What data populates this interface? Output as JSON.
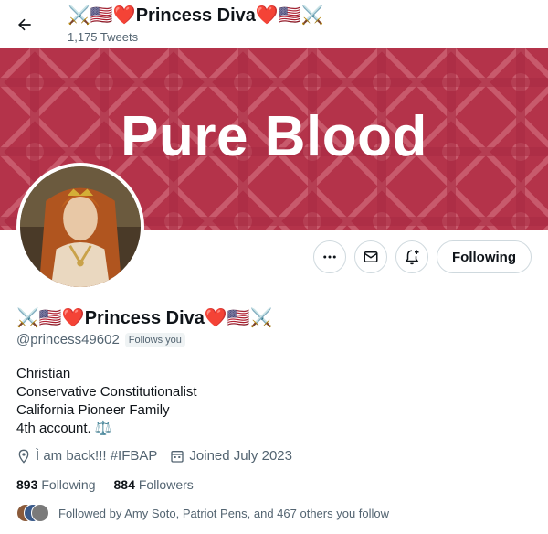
{
  "header": {
    "title": "⚔️🇺🇸❤️Princess Diva❤️🇺🇸⚔️",
    "tweet_count": "1,175 Tweets"
  },
  "banner": {
    "text": "Pure Blood",
    "background_color": "#b4334a"
  },
  "actions": {
    "more_icon": "more-icon",
    "message_icon": "mail-icon",
    "notify_icon": "bell-plus-icon",
    "follow_label": "Following"
  },
  "profile": {
    "name": "⚔️🇺🇸❤️Princess Diva❤️🇺🇸⚔️",
    "handle": "@princess49602",
    "follows_you": "Follows you",
    "bio": [
      "Christian",
      "Conservative Constitutionalist",
      "California Pioneer Family",
      "4th  account.  ⚖️"
    ],
    "location": "Ì am back!!! #IFBAP",
    "joined": "Joined July 2023"
  },
  "stats": {
    "following_count": "893",
    "following_label": "Following",
    "followers_count": "884",
    "followers_label": "Followers"
  },
  "followed_by": "Followed by Amy Soto, Patriot Pens, and 467 others you follow"
}
